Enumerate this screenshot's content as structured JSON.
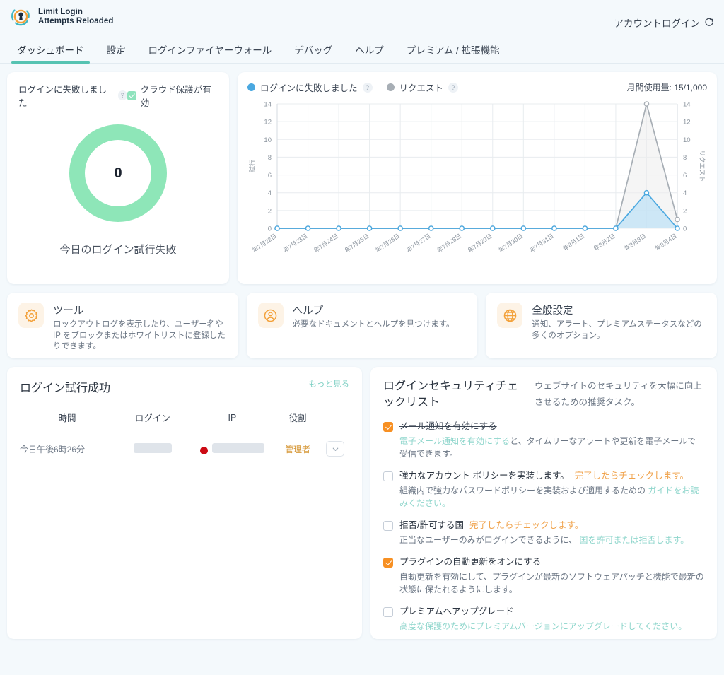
{
  "header": {
    "brand_line1": "Limit Login",
    "brand_line2": "Attempts Reloaded",
    "logo_icon": "keyhole-shield-logo",
    "account_label": "アカウントログイン",
    "account_icon": "external-link-icon"
  },
  "nav": {
    "items": [
      {
        "label": "ダッシュボード",
        "active": true
      },
      {
        "label": "設定",
        "active": false
      },
      {
        "label": "ログインファイヤーウォール",
        "active": false
      },
      {
        "label": "デバッグ",
        "active": false
      },
      {
        "label": "ヘルプ",
        "active": false
      },
      {
        "label": "プレミアム / 拡張機能",
        "active": false
      }
    ]
  },
  "donut_card": {
    "title": "ログインに失敗しました",
    "help_icon": "question-mark-icon",
    "cloud_badge": "クラウド保護が有効",
    "cloud_icon": "check-badge-icon",
    "value": "0",
    "caption": "今日のログイン試行失敗",
    "ring_color": "#8ee6b8"
  },
  "chart_card": {
    "legend": [
      {
        "label": "ログインに失敗しました",
        "color": "#4aa8e0",
        "help_icon": "question-mark-icon"
      },
      {
        "label": "リクエスト",
        "color": "#a7aeb5",
        "help_icon": "question-mark-icon"
      }
    ],
    "usage_label": "月間使用量: 15/1,000"
  },
  "chart_data": {
    "type": "line",
    "title": "",
    "xlabel": "",
    "ylabel": "試行",
    "y2label": "リクエスト",
    "categories": [
      "年7月22日",
      "年7月23日",
      "年7月24日",
      "年7月25日",
      "年7月26日",
      "年7月27日",
      "年7月28日",
      "年7月29日",
      "年7月30日",
      "年7月31日",
      "年8月1日",
      "年8月2日",
      "年8月3日",
      "年8月4日"
    ],
    "yticks": [
      0,
      2,
      4,
      6,
      8,
      10,
      12,
      14
    ],
    "ylim": [
      0,
      14
    ],
    "y2ticks": [
      0,
      2,
      4,
      6,
      8,
      10,
      12,
      14
    ],
    "y2lim": [
      0,
      14
    ],
    "grid": true,
    "legend_position": "top-left",
    "series": [
      {
        "name": "ログインに失敗しました",
        "color": "#4aa8e0",
        "fill": "#bfe2f5",
        "axis": "left",
        "values": [
          0,
          0,
          0,
          0,
          0,
          0,
          0,
          0,
          0,
          0,
          0,
          0,
          4,
          0
        ]
      },
      {
        "name": "リクエスト",
        "color": "#a7aeb5",
        "fill": "#ececec",
        "axis": "right",
        "values": [
          0,
          0,
          0,
          0,
          0,
          0,
          0,
          0,
          0,
          0,
          0,
          0,
          14,
          1
        ]
      }
    ]
  },
  "feature_cards": [
    {
      "icon": "gear-icon",
      "title": "ツール",
      "desc": "ロックアウトログを表示したり、ユーザー名や IP をブロックまたはホワイトリストに登録したりできます。"
    },
    {
      "icon": "user-circle-icon",
      "title": "ヘルプ",
      "desc": "必要なドキュメントとヘルプを見つけます。"
    },
    {
      "icon": "globe-icon",
      "title": "全般設定",
      "desc": "通知、アラート、プレミアムステータスなどの多くのオプション。"
    }
  ],
  "attempts_card": {
    "title": "ログイン試行成功",
    "see_more": "もっと見る",
    "columns": [
      "時間",
      "ログイン",
      "IP",
      "役割"
    ],
    "rows": [
      {
        "time": "今日午後6時26分",
        "login": "",
        "login_redacted": true,
        "ip": "",
        "ip_redacted": true,
        "flag_icon": "red-dot-flag-icon",
        "role": "管理者",
        "expand_icon": "chevron-down-icon"
      }
    ]
  },
  "checklist_card": {
    "title": "ログインセキュリティチェックリスト",
    "subtitle": "ウェブサイトのセキュリティを大幅に向上させるための推奨タスク。",
    "items": [
      {
        "checked": true,
        "label": "メール通知を有効にする",
        "hint": "",
        "desc_pre": "",
        "desc_link": "電子メール通知を有効にする",
        "desc_post": "と、タイムリーなアラートや更新を電子メールで受信できます。"
      },
      {
        "checked": false,
        "label": "強力なアカウント ポリシーを実装します。",
        "hint": "完了したらチェックします。",
        "desc_pre": "組織内で強力なパスワードポリシーを実装および適用するための ",
        "desc_link": "ガイドをお読みください。",
        "desc_post": ""
      },
      {
        "checked": false,
        "label": "拒否/許可する国",
        "hint": "完了したらチェックします。",
        "desc_pre": "正当なユーザーのみがログインできるように、 ",
        "desc_link": "国を許可または拒否します。",
        "desc_post": ""
      },
      {
        "checked": true,
        "label": "プラグインの自動更新をオンにする",
        "hint": "",
        "desc_pre": "自動更新を有効にして、プラグインが最新のソフトウェアパッチと機能で最新の状態に保たれるようにします。",
        "desc_link": "",
        "desc_post": ""
      },
      {
        "checked": false,
        "label": "プレミアムへアップグレード",
        "hint": "",
        "desc_pre": "",
        "desc_link": "高度な保護のためにプレミアムバージョンにアップグレードしてください。",
        "desc_post": ""
      }
    ]
  }
}
